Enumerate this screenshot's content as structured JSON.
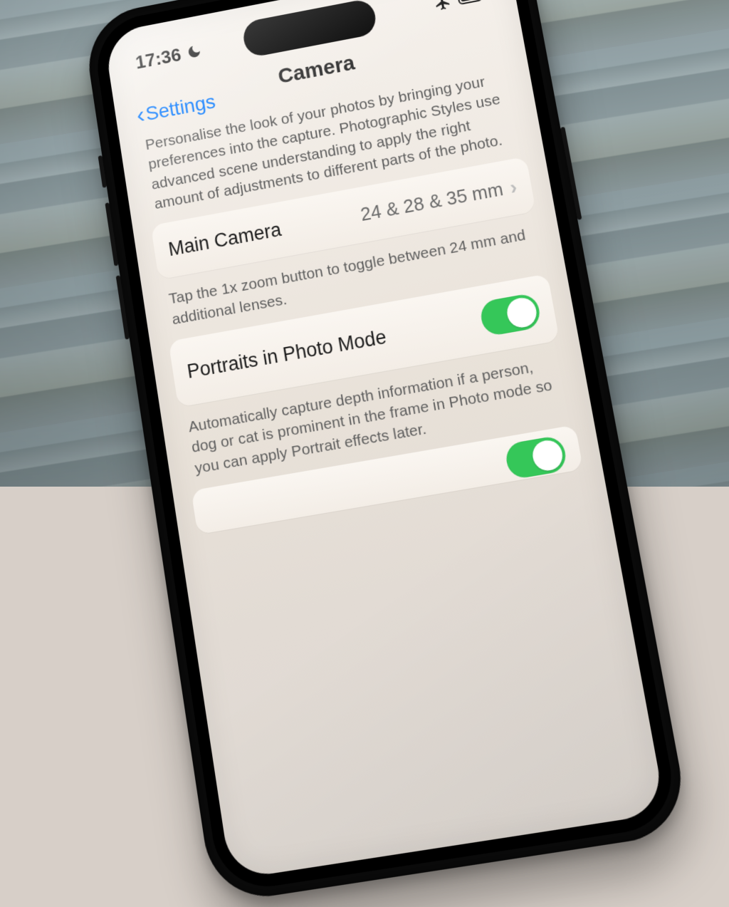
{
  "status": {
    "time": "17:36",
    "dnd_icon": "moon-icon",
    "airplane_icon": "airplane-icon",
    "battery_icon": "battery-icon"
  },
  "nav": {
    "back_label": "Settings",
    "title": "Camera"
  },
  "sections": {
    "styles_caption": "Personalise the look of your photos by bringing your preferences into the capture. Photographic Styles use advanced scene understanding to apply the right amount of adjustments to different parts of the photo.",
    "main_camera": {
      "label": "Main Camera",
      "value": "24 & 28 & 35 mm",
      "caption": "Tap the 1x zoom button to toggle between 24 mm and additional lenses."
    },
    "portraits": {
      "label": "Portraits in Photo Mode",
      "enabled": true,
      "caption": "Automatically capture depth information if a person, dog or cat is prominent in the frame in Photo mode so you can apply Portrait effects later."
    }
  }
}
